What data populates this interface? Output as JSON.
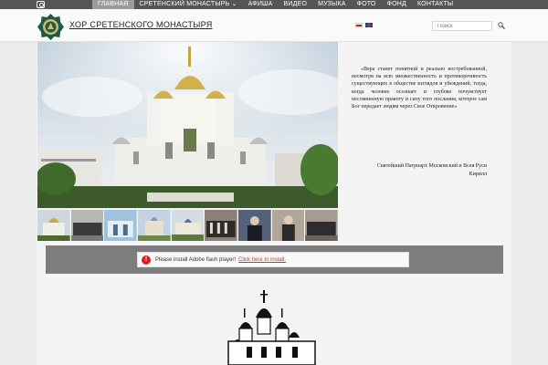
{
  "topbar": {
    "icons": {
      "instagram": "instagram-icon"
    },
    "nav": [
      {
        "label": "ГЛАВНАЯ",
        "active": true
      },
      {
        "label": "СРЕТЕНСКИЙ МОНАСТЫРЬ ⌄",
        "active": false
      },
      {
        "label": "АФИША",
        "active": false
      },
      {
        "label": "ВИДЕО",
        "active": false
      },
      {
        "label": "МУЗЫКА",
        "active": false
      },
      {
        "label": "ФОТО",
        "active": false
      },
      {
        "label": "ФОНД",
        "active": false
      },
      {
        "label": "КОНТАКТЫ",
        "active": false
      }
    ]
  },
  "header": {
    "title": "ХОР СРЕТЕНСКОГО МОНАСТЫРЯ",
    "search_placeholder": "Поиск"
  },
  "quote": {
    "text": "«Вера станет понятной и реально востребованной, несмотря на всю множественность и противоречивость существующих в обществе взглядов и убеждений, тогда, когда человек осознает и глубоко почувствует несомненную правоту и силу того послания, которое сам Бог передает людям через Свое Откровение»",
    "author": "Святейший Патриарх Московский и Всея Руси Кирилл"
  },
  "flash": {
    "message": "Please install Adobe flash player!",
    "link": "Click here to install."
  },
  "colors": {
    "topbar": "#555555",
    "nav_active": "#9b9b9b",
    "flash_bar": "#7d7d7d",
    "warning": "#d82020"
  }
}
